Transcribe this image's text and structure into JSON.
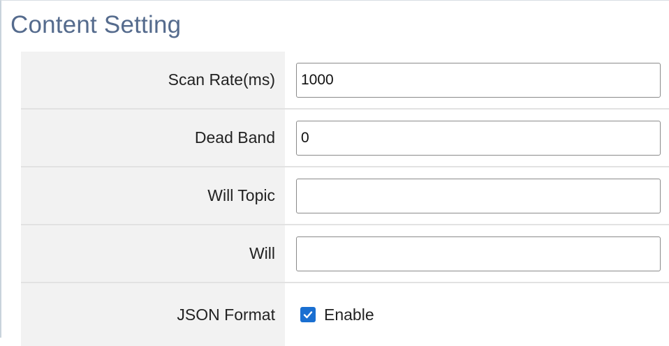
{
  "section": {
    "title": "Content Setting"
  },
  "form": {
    "scan_rate": {
      "label": "Scan Rate(ms)",
      "value": "1000",
      "placeholder": ""
    },
    "dead_band": {
      "label": "Dead Band",
      "value": "0",
      "placeholder": ""
    },
    "will_topic": {
      "label": "Will Topic",
      "value": "",
      "placeholder": ""
    },
    "will": {
      "label": "Will",
      "value": "",
      "placeholder": ""
    },
    "json_format": {
      "label": "JSON Format",
      "checkbox_label": "Enable",
      "checked": true
    }
  },
  "colors": {
    "title": "#556b8d",
    "label_bg": "#f2f2f2",
    "checkbox": "#1a6fd1"
  },
  "icons": {
    "checkbox": "checkmark-icon"
  }
}
